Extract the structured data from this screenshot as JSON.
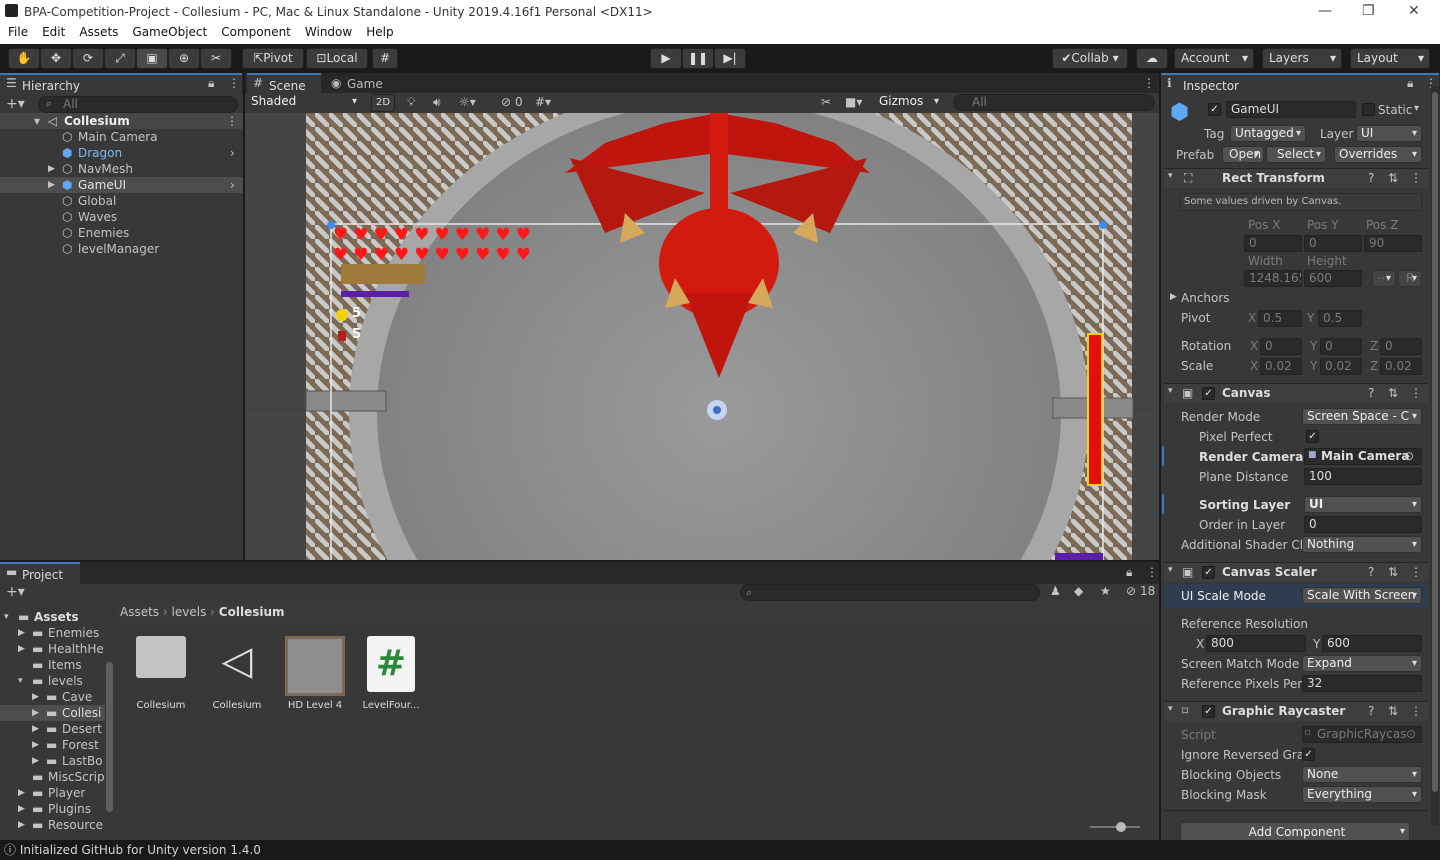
{
  "title": "BPA-Competition-Project - Collesium - PC, Mac & Linux Standalone - Unity 2019.4.16f1 Personal <DX11>",
  "menu": [
    "File",
    "Edit",
    "Assets",
    "GameObject",
    "Component",
    "Window",
    "Help"
  ],
  "toolbar": {
    "pivot": "Pivot",
    "local": "Local",
    "collab": "Collab",
    "account": "Account",
    "layers": "Layers",
    "layout": "Layout"
  },
  "hierarchy": {
    "tab": "Hierarchy",
    "search": "All",
    "scene": "Collesium",
    "items": [
      "Main Camera",
      "Dragon",
      "NavMesh",
      "GameUI",
      "Global",
      "Waves",
      "Enemies",
      "levelManager"
    ]
  },
  "scene_view": {
    "tab_scene": "Scene",
    "tab_game": "Game",
    "shading": "Shaded",
    "mode2d": "2D",
    "hidden_count": "0",
    "gizmos": "Gizmos",
    "search": "All",
    "coin_count": "5",
    "potion_count": "5",
    "heart_rows": 2,
    "hearts_per_row": 10,
    "colors": {
      "dragon": "#c0150d",
      "health": "#e30f0f",
      "mana": "#5b1fa8",
      "floor": "#8f8f8f"
    }
  },
  "project": {
    "tab": "Project",
    "hidden_count": "18",
    "breadcrumb": [
      "Assets",
      "levels",
      "Collesium"
    ],
    "tree": [
      "Assets",
      "Enemies",
      "HealthHe",
      "Items",
      "levels",
      "Cave",
      "Collesi",
      "Desert",
      "Forest",
      "LastBo",
      "MiscScrip",
      "Player",
      "Plugins",
      "Resource"
    ],
    "assets": [
      "Collesium",
      "Collesium",
      "HD Level 4",
      "LevelFour..."
    ]
  },
  "inspector": {
    "tab": "Inspector",
    "name": "GameUI",
    "static": "Static",
    "tag_label": "Tag",
    "tag": "Untagged",
    "layer_label": "Layer",
    "layer": "UI",
    "prefab_label": "Prefab",
    "open": "Open",
    "select": "Select",
    "overrides": "Overrides",
    "rect": {
      "header": "Rect Transform",
      "note": "Some values driven by Canvas.",
      "posx_l": "Pos X",
      "posy_l": "Pos Y",
      "posz_l": "Pos Z",
      "posx": "0",
      "posy": "0",
      "posz": "90",
      "width_l": "Width",
      "height_l": "Height",
      "width": "1248.165",
      "height": "600",
      "r": "R",
      "anchors": "Anchors",
      "pivot": "Pivot",
      "pivot_x": "0.5",
      "pivot_y": "0.5",
      "rotation": "Rotation",
      "rot_x": "0",
      "rot_y": "0",
      "rot_z": "0",
      "scale": "Scale",
      "scale_x": "0.02",
      "scale_y": "0.02",
      "scale_z": "0.02",
      "x": "X",
      "y": "Y",
      "z": "Z"
    },
    "canvas": {
      "header": "Canvas",
      "render_mode_l": "Render Mode",
      "render_mode": "Screen Space - C",
      "pixel_perfect_l": "Pixel Perfect",
      "render_camera_l": "Render Camera",
      "render_camera": "Main Camera",
      "plane_distance_l": "Plane Distance",
      "plane_distance": "100",
      "sorting_layer_l": "Sorting Layer",
      "sorting_layer": "UI",
      "order_l": "Order in Layer",
      "order": "0",
      "shader_l": "Additional Shader Ch",
      "shader": "Nothing"
    },
    "scaler": {
      "header": "Canvas Scaler",
      "mode_l": "UI Scale Mode",
      "mode": "Scale With Screen",
      "ref_res_l": "Reference Resolution",
      "x": "X",
      "y": "Y",
      "ref_x": "800",
      "ref_y": "600",
      "match_l": "Screen Match Mode",
      "match": "Expand",
      "ppu_l": "Reference Pixels Per",
      "ppu": "32"
    },
    "raycaster": {
      "header": "Graphic Raycaster",
      "script_l": "Script",
      "script": "GraphicRaycas",
      "ignore_l": "Ignore Reversed Grap",
      "blocking_l": "Blocking Objects",
      "blocking": "None",
      "mask_l": "Blocking Mask",
      "mask": "Everything"
    },
    "add_component": "Add Component"
  },
  "status": "Initialized GitHub for Unity version 1.4.0"
}
